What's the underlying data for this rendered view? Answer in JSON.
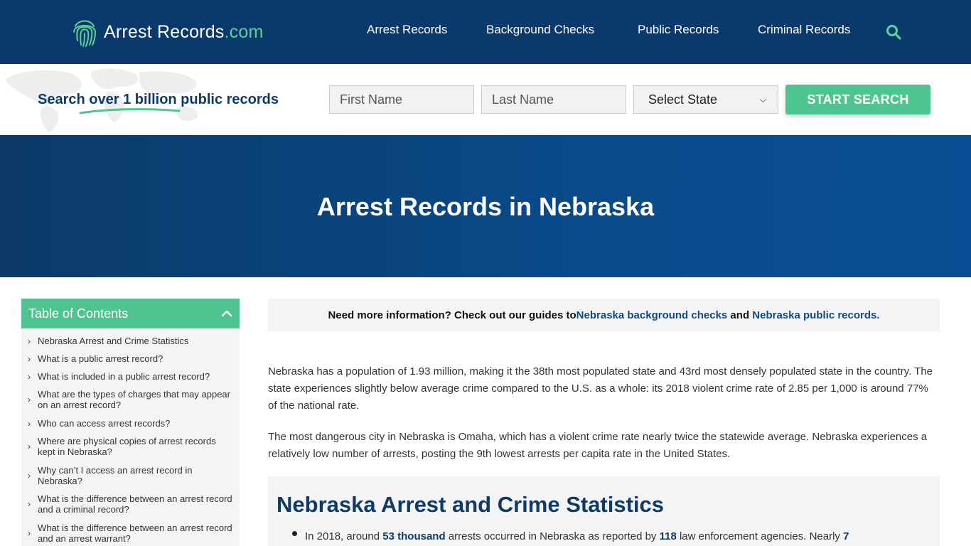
{
  "brand": {
    "name": "Arrest Records",
    "suffix": ".com"
  },
  "nav": {
    "items": [
      {
        "label": "Arrest Records"
      },
      {
        "label": "Background Checks"
      },
      {
        "label": "Public Records"
      },
      {
        "label": "Criminal Records"
      }
    ]
  },
  "search": {
    "tagline": "Search over 1 billion public records",
    "first_name_placeholder": "First Name",
    "last_name_placeholder": "Last Name",
    "state_selected": "Select State",
    "button_label": "START SEARCH"
  },
  "hero": {
    "title": "Arrest Records in Nebraska"
  },
  "toc": {
    "title": "Table of Contents",
    "items": [
      "Nebraska Arrest and Crime Statistics",
      "What is a public arrest record?",
      "What is included in a public arrest record?",
      "What are the types of charges that may appear on an arrest record?",
      "Who can access arrest records?",
      "Where are physical copies of arrest records kept in Nebraska?",
      "Why can’t I access an arrest record in Nebraska?",
      "What is the difference between an arrest record and a criminal record?",
      "What is the difference between an arrest record and an arrest warrant?"
    ]
  },
  "notice": {
    "prefix": "Need more information? Check out our guides to ",
    "link1": "Nebraska background checks",
    "middle": " and ",
    "link2": "Nebraska public records."
  },
  "content": {
    "para1": "Nebraska has a population of 1.93 million, making it the 38th most populated state and 43rd most densely populated state in the country. The state experiences slightly below average crime compared to the U.S. as a whole: its 2018 violent crime rate of 2.85 per 1,000 is around 77% of the national rate.",
    "para2": "The most dangerous city in Nebraska is Omaha, which has a violent crime rate nearly twice the statewide average. Nebraska experiences a relatively low number of arrests, posting the 9th lowest arrests per capita rate in the United States.",
    "stats_heading": "Nebraska Arrest and Crime Statistics",
    "stats_bullet": {
      "t1": "In 2018, around ",
      "b1": "53 thousand",
      "t2": " arrests occurred in Nebraska as reported by ",
      "b2": "118",
      "t3": " law enforcement agencies. Nearly ",
      "b3": "7"
    }
  },
  "colors": {
    "navy": "#0a3a6b",
    "accent_green": "#4ec590",
    "link_blue": "#0e4a86"
  }
}
